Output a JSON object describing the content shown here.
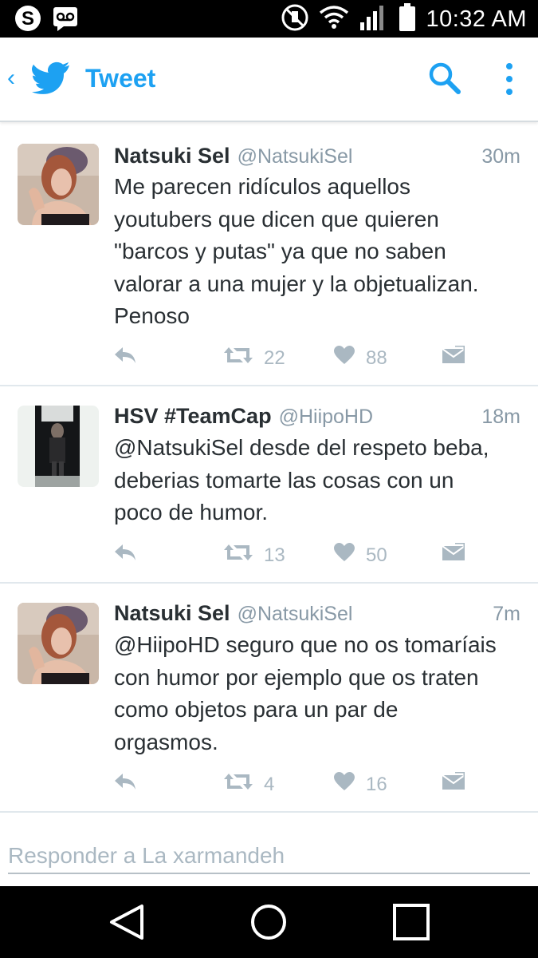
{
  "status_bar": {
    "time": "10:32 AM",
    "left_icons": [
      "skype-icon",
      "voicemail-icon"
    ],
    "right_icons": [
      "do-not-disturb-icon",
      "wifi-icon",
      "signal-icon",
      "battery-icon"
    ]
  },
  "app_bar": {
    "title": "Tweet",
    "accent_color": "#1da1f2"
  },
  "tweets": [
    {
      "name": "Natsuki Sel",
      "handle": "@NatsukiSel",
      "time": "30m",
      "lines": [
        "Me parecen ridículos aquellos",
        "youtubers que dicen que quieren",
        "\"barcos y putas\" ya que no saben",
        "valorar a una mujer y la objetualizan.",
        "Penoso"
      ],
      "retweets": "22",
      "likes": "88"
    },
    {
      "name": "HSV #TeamCap",
      "handle": "@HiipoHD",
      "time": "18m",
      "lines": [
        "@NatsukiSel desde del respeto beba,",
        "deberias tomarte las cosas con un",
        "poco de humor."
      ],
      "retweets": "13",
      "likes": "50"
    },
    {
      "name": "Natsuki Sel",
      "handle": "@NatsukiSel",
      "time": "7m",
      "lines": [
        "@HiipoHD seguro que no os tomaríais",
        "con humor por ejemplo que os traten",
        "como objetos para un par de",
        "orgasmos."
      ],
      "retweets": "4",
      "likes": "16"
    }
  ],
  "reply": {
    "placeholder": "Responder a La xarmandeh"
  },
  "nav_bar": {
    "buttons": [
      "back-triangle-icon",
      "home-circle-icon",
      "recents-square-icon"
    ]
  }
}
